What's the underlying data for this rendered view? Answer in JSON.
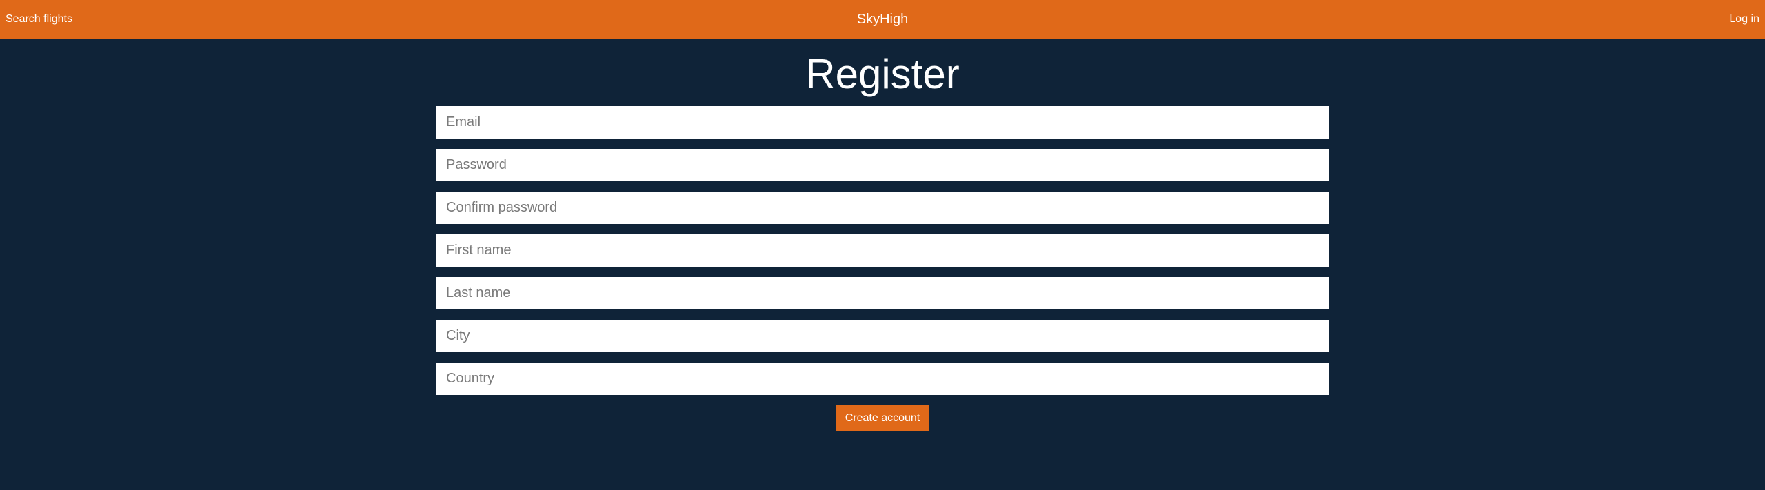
{
  "navbar": {
    "left_link": "Search flights",
    "brand": "SkyHigh",
    "right_link": "Log in",
    "color": "#e06919"
  },
  "page": {
    "title": "Register",
    "background": "#0f2338"
  },
  "form": {
    "email_placeholder": "Email",
    "password_placeholder": "Password",
    "confirm_password_placeholder": "Confirm password",
    "first_name_placeholder": "First name",
    "last_name_placeholder": "Last name",
    "city_placeholder": "City",
    "country_placeholder": "Country",
    "email_value": "",
    "password_value": "",
    "confirm_password_value": "",
    "first_name_value": "",
    "last_name_value": "",
    "city_value": "",
    "country_value": "",
    "submit_label": "Create account"
  }
}
